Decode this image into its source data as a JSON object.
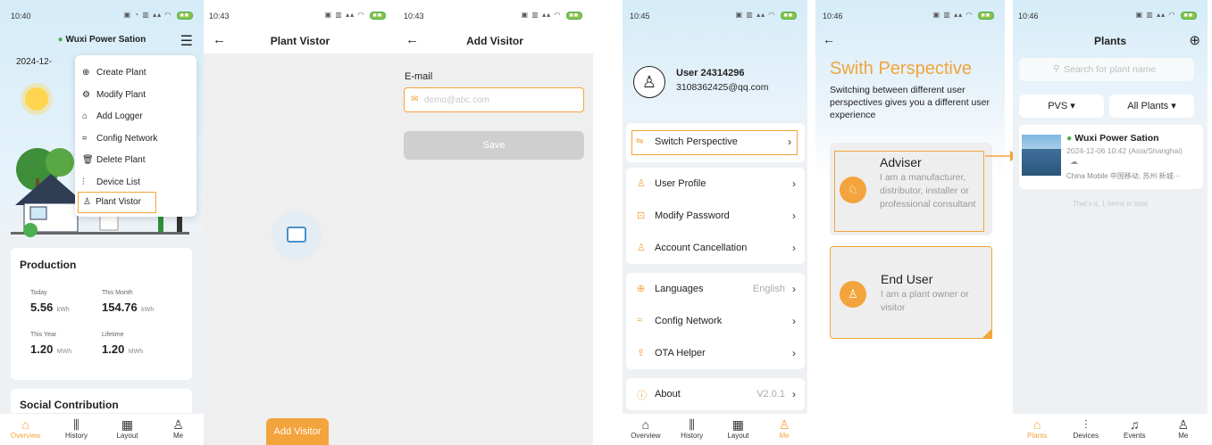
{
  "colors": {
    "accent": "#f3a43c",
    "online": "#4caf50",
    "grey_bg": "#efefef"
  },
  "screen1": {
    "time": "10:40",
    "plant_name": "Wuxi Power Sation",
    "date": "2024-12-",
    "menu": [
      "Create Plant",
      "Modify Plant",
      "Add Logger",
      "Config Network",
      "Delete Plant",
      "Device List",
      "Plant Vistor"
    ],
    "menu_icons": [
      "plus-circle-icon",
      "settings-icon",
      "logger-icon",
      "wifi-icon",
      "trash-icon",
      "device-list-icon",
      "visitor-icon"
    ],
    "production_title": "Production",
    "today_label": "Today",
    "today_value": "5.56",
    "today_unit": "kWh",
    "month_label": "This Month",
    "month_value": "154.76",
    "month_unit": "kWh",
    "year_label": "This Year",
    "year_value": "1.20",
    "year_unit": "MWh",
    "lifetime_label": "Lifetime",
    "lifetime_value": "1.20",
    "lifetime_unit": "MWh",
    "social_title": "Social Contribution",
    "nav": [
      "Overview",
      "History",
      "Layout",
      "Me"
    ]
  },
  "screen2": {
    "time": "10:43",
    "title": "Plant Vistor",
    "add_button": "Add Visitor"
  },
  "screen3": {
    "time": "10:43",
    "title": "Add Visitor",
    "email_label": "E-mail",
    "email_placeholder": "demo@abc.com",
    "save_label": "Save"
  },
  "screen4": {
    "time": "10:45",
    "user_name": "User 24314296",
    "user_email": "3108362425@qq.com",
    "items": [
      {
        "label": "Switch Perspective",
        "value": ""
      },
      {
        "label": "User Profile",
        "value": ""
      },
      {
        "label": "Modify Password",
        "value": ""
      },
      {
        "label": "Account Cancellation",
        "value": ""
      },
      {
        "label": "Languages",
        "value": "English"
      },
      {
        "label": "Config Network",
        "value": ""
      },
      {
        "label": "OTA Helper",
        "value": ""
      },
      {
        "label": "About",
        "value": "V2.0.1"
      }
    ],
    "nav": [
      "Overview",
      "History",
      "Layout",
      "Me"
    ]
  },
  "screen5": {
    "time": "10:46",
    "title": "Swith Perspective",
    "desc": "Switching between different user perspectives gives you a different user experience",
    "adviser_title": "Adviser",
    "adviser_desc": "I am a manufacturer, distributor, installer or professional consultant",
    "enduser_title": "End User",
    "enduser_desc": "I am a plant owner or visitor"
  },
  "screen6": {
    "time": "10:46",
    "title": "Plants",
    "search_placeholder": "Search for plant name",
    "filter1": "PVS",
    "filter2": "All Plants",
    "plant_name": "Wuxi Power Sation",
    "plant_time": "2024-12-06 10:42 (Asia/Shanghai)",
    "plant_location": "China Mobile 中国移动, 苏州 新城···",
    "total_text": "That’s it, 1 items in total",
    "nav": [
      "Plants",
      "Devices",
      "Events",
      "Me"
    ]
  }
}
